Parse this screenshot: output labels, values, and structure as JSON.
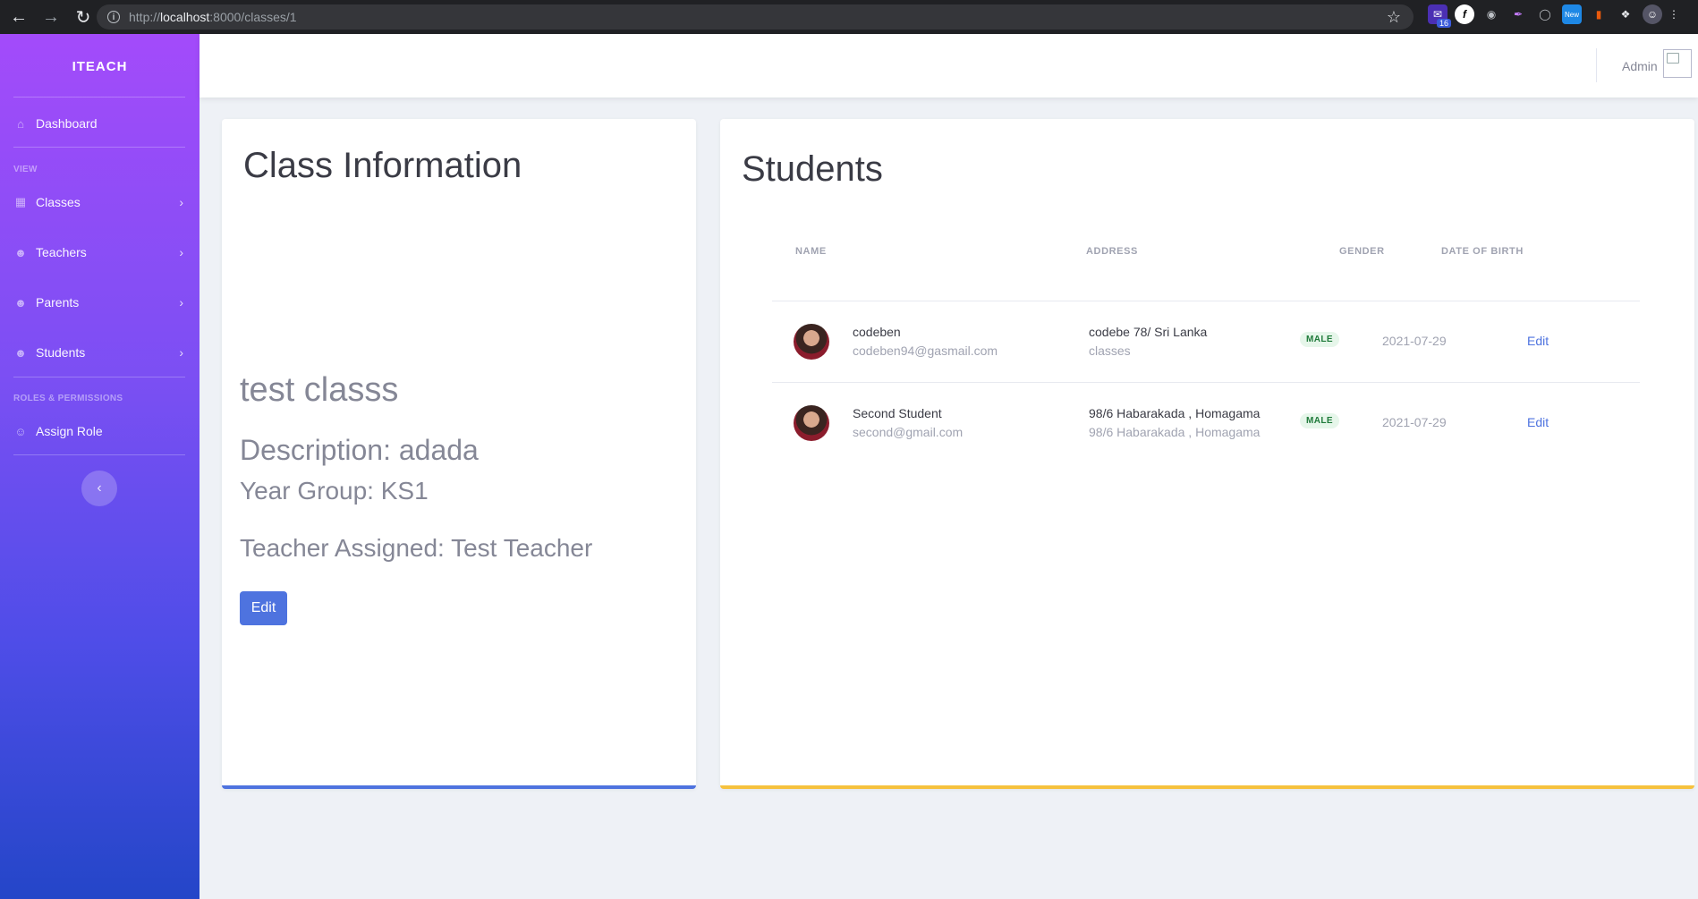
{
  "browser": {
    "url_prefix": "http://",
    "url_host": "localhost",
    "url_rest": ":8000/classes/1",
    "ext_badge_count": "16",
    "ext_new_badge": "New"
  },
  "sidebar": {
    "brand": "ITEACH",
    "dashboard": "Dashboard",
    "heading_view": "VIEW",
    "items": [
      {
        "label": "Classes"
      },
      {
        "label": "Teachers"
      },
      {
        "label": "Parents"
      },
      {
        "label": "Students"
      }
    ],
    "heading_roles": "ROLES & PERMISSIONS",
    "assign_role": "Assign Role"
  },
  "topbar": {
    "user_name": "Admin"
  },
  "class_info": {
    "title": "Class Information",
    "name": "test classs",
    "description": "Description: adada",
    "year_group": "Year Group: KS1",
    "teacher": "Teacher Assigned: Test Teacher",
    "edit_label": "Edit"
  },
  "students": {
    "title": "Students",
    "columns": [
      "NAME",
      "ADDRESS",
      "GENDER",
      "DATE OF BIRTH"
    ],
    "rows": [
      {
        "name": "codeben",
        "email": "codeben94@gasmail.com",
        "address_line1": "codebe 78/ Sri Lanka",
        "address_line2": "classes",
        "gender": "MALE",
        "dob": "2021-07-29",
        "action": "Edit"
      },
      {
        "name": "Second Student",
        "email": "second@gmail.com",
        "address_line1": "98/6 Habarakada , Homagama",
        "address_line2": "98/6 Habarakada , Homagama",
        "gender": "MALE",
        "dob": "2021-07-29",
        "action": "Edit"
      }
    ]
  },
  "colors": {
    "primary": "#4e73df",
    "warning": "#f6c23e",
    "sidebar_top": "#a34bfa",
    "sidebar_bottom": "#2446c8"
  }
}
